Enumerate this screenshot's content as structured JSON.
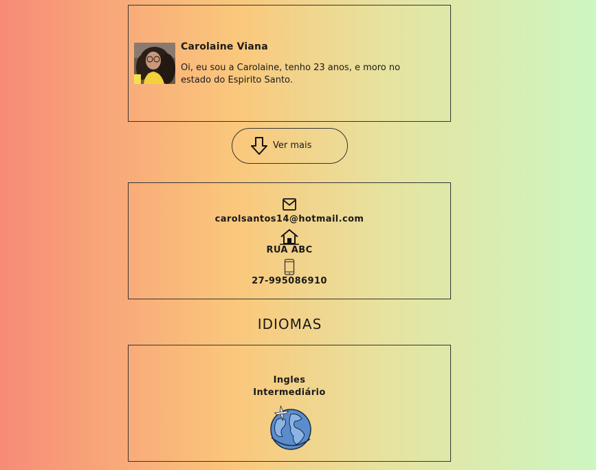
{
  "profile": {
    "name": "Carolaine Viana",
    "bio": "Oi, eu sou a Carolaine, tenho 23 anos, e moro no estado do Espirito Santo."
  },
  "more_button": {
    "label": "Ver mais",
    "icon": "arrow-down-icon"
  },
  "contact": {
    "email": "carolsantos14@hotmail.com",
    "email_icon": "envelope-icon",
    "address": "RUA ABC",
    "address_icon": "house-icon",
    "phone": "27-995086910",
    "phone_icon": "phone-icon"
  },
  "languages": {
    "title": "IDIOMAS",
    "items": [
      {
        "language": "Ingles",
        "level": "Intermediário"
      }
    ],
    "icon": "globe-plane-icon"
  }
}
